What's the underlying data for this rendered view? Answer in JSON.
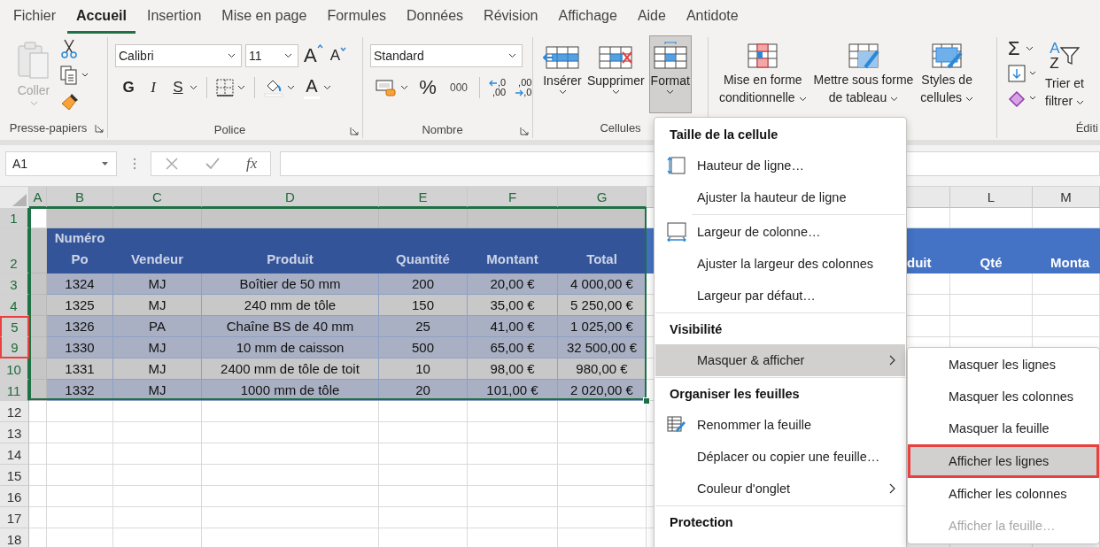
{
  "tabs": [
    {
      "label": "Fichier",
      "selected": false
    },
    {
      "label": "Accueil",
      "selected": true
    },
    {
      "label": "Insertion",
      "selected": false
    },
    {
      "label": "Mise en page",
      "selected": false
    },
    {
      "label": "Formules",
      "selected": false
    },
    {
      "label": "Données",
      "selected": false
    },
    {
      "label": "Révision",
      "selected": false
    },
    {
      "label": "Affichage",
      "selected": false
    },
    {
      "label": "Aide",
      "selected": false
    },
    {
      "label": "Antidote",
      "selected": false
    }
  ],
  "clipboard": {
    "paste": {
      "label": "Coller",
      "disabled": true
    },
    "label": "Presse-papiers"
  },
  "font": {
    "family": "Calibri",
    "size": "11",
    "grow": "A",
    "shrink": "A",
    "bold": "G",
    "italic": "I",
    "underline": "S",
    "color_letter": "A",
    "label": "Police"
  },
  "number": {
    "format": "Standard",
    "percent": "%",
    "thousands": "000",
    "increase_decimal": [
      ",0",
      ",00"
    ],
    "decrease_decimal": [
      ",00",
      ",0"
    ],
    "label": "Nombre"
  },
  "cells": {
    "buttons": [
      {
        "label": "Insérer",
        "pressed": false
      },
      {
        "label": "Supprimer",
        "pressed": false
      },
      {
        "label": "Format",
        "pressed": true
      }
    ],
    "label": "Cellules"
  },
  "styles": {
    "buttons": [
      {
        "lines": [
          "Mise en forme",
          "conditionnelle"
        ]
      },
      {
        "lines": [
          "Mettre sous forme",
          "de tableau"
        ]
      },
      {
        "lines": [
          "Styles de",
          "cellules"
        ]
      }
    ]
  },
  "editing": {
    "autosum": "Σ",
    "sort_letters": [
      "A",
      "Z"
    ],
    "sort_lines": [
      "Trier et",
      "filtrer"
    ],
    "label": "Éditi"
  },
  "formula_bar": {
    "name_box": "A1",
    "fx": "fx"
  },
  "columns": [
    {
      "label": "A",
      "selected": true
    },
    {
      "label": "B",
      "selected": true
    },
    {
      "label": "C",
      "selected": true
    },
    {
      "label": "D",
      "selected": true
    },
    {
      "label": "E",
      "selected": true
    },
    {
      "label": "F",
      "selected": true
    },
    {
      "label": "G",
      "selected": true
    },
    {
      "label": "L",
      "selected": false
    },
    {
      "label": "M",
      "selected": false
    }
  ],
  "rows": [
    {
      "label": "1",
      "selected": true,
      "active": true,
      "annotated": false
    },
    {
      "label": "2",
      "selected": true,
      "active": false,
      "annotated": false
    },
    {
      "label": "3",
      "selected": true,
      "active": false,
      "annotated": false
    },
    {
      "label": "4",
      "selected": true,
      "active": false,
      "annotated": false
    },
    {
      "label": "5",
      "selected": true,
      "active": false,
      "annotated": true
    },
    {
      "label": "9",
      "selected": true,
      "active": false,
      "annotated": true
    },
    {
      "label": "10",
      "selected": true,
      "active": false,
      "annotated": false
    },
    {
      "label": "11",
      "selected": true,
      "active": false,
      "annotated": false
    },
    {
      "label": "12",
      "selected": false,
      "annotated": false
    },
    {
      "label": "13",
      "selected": false,
      "annotated": false
    },
    {
      "label": "14",
      "selected": false,
      "annotated": false
    },
    {
      "label": "15",
      "selected": false,
      "annotated": false
    },
    {
      "label": "16",
      "selected": false,
      "annotated": false
    },
    {
      "label": "17",
      "selected": false,
      "annotated": false
    },
    {
      "label": "18",
      "selected": false,
      "annotated": false
    }
  ],
  "table": {
    "header": [
      "Numéro Po",
      "Vendeur",
      "Produit",
      "Quantité",
      "Montant",
      "Total"
    ],
    "rows": [
      {
        "cells": [
          "1324",
          "MJ",
          "Boîtier de 50 mm",
          "200",
          "20,00 €",
          "4 000,00 €"
        ],
        "shaded": true
      },
      {
        "cells": [
          "1325",
          "MJ",
          "240 mm de tôle",
          "150",
          "35,00 €",
          "5 250,00 €"
        ],
        "shaded": false
      },
      {
        "cells": [
          "1326",
          "PA",
          "Chaîne BS de 40 mm",
          "25",
          "41,00 €",
          "1 025,00 €"
        ],
        "shaded": true
      },
      {
        "cells": [
          "1330",
          "MJ",
          "10 mm de caisson",
          "500",
          "65,00 €",
          "32 500,00 €"
        ],
        "shaded": true
      },
      {
        "cells": [
          "1331",
          "MJ",
          "2400 mm de tôle de toit",
          "10",
          "98,00 €",
          "980,00 €"
        ],
        "shaded": false
      },
      {
        "cells": [
          "1332",
          "MJ",
          "1000 mm de tôle",
          "20",
          "101,00 €",
          "2 020,00 €"
        ],
        "shaded": true
      }
    ]
  },
  "right_table": {
    "headers": [
      "duit",
      "Qté",
      "Monta"
    ]
  },
  "menu": [
    {
      "kind": "heading",
      "label": "Taille de la cellule"
    },
    {
      "kind": "row-height-item",
      "label": "Hauteur de ligne…",
      "selected": false
    },
    {
      "kind": "item",
      "label": "Ajuster la hauteur de ligne",
      "selected": false
    },
    {
      "kind": "separator"
    },
    {
      "kind": "column-width-item",
      "label": "Largeur de colonne…",
      "selected": false
    },
    {
      "kind": "item",
      "label": "Ajuster la largeur des colonnes",
      "selected": false
    },
    {
      "kind": "item",
      "label": "Largeur par défaut…",
      "selected": false
    },
    {
      "kind": "separator"
    },
    {
      "kind": "heading",
      "label": "Visibilité"
    },
    {
      "kind": "submenu-item",
      "label": "Masquer & afficher",
      "selected": true
    },
    {
      "kind": "separator"
    },
    {
      "kind": "heading",
      "label": "Organiser les feuilles"
    },
    {
      "kind": "rename-item",
      "label": "Renommer la feuille",
      "selected": false
    },
    {
      "kind": "item",
      "label": "Déplacer ou copier une feuille…",
      "selected": false
    },
    {
      "kind": "submenu-item",
      "label": "Couleur d'onglet",
      "selected": false
    },
    {
      "kind": "separator"
    },
    {
      "kind": "heading",
      "label": "Protection"
    }
  ],
  "submenu": [
    {
      "label": "Masquer les lignes",
      "selected": false,
      "disabled": false,
      "annotated": false
    },
    {
      "label": "Masquer les colonnes",
      "selected": false,
      "disabled": false,
      "annotated": false
    },
    {
      "label": "Masquer la feuille",
      "selected": false,
      "disabled": false,
      "annotated": false
    },
    {
      "label": "Afficher les lignes",
      "selected": true,
      "disabled": false,
      "annotated": true
    },
    {
      "label": "Afficher les colonnes",
      "selected": false,
      "disabled": false,
      "annotated": false
    },
    {
      "label": "Afficher la feuille…",
      "selected": false,
      "disabled": true,
      "annotated": false
    }
  ]
}
